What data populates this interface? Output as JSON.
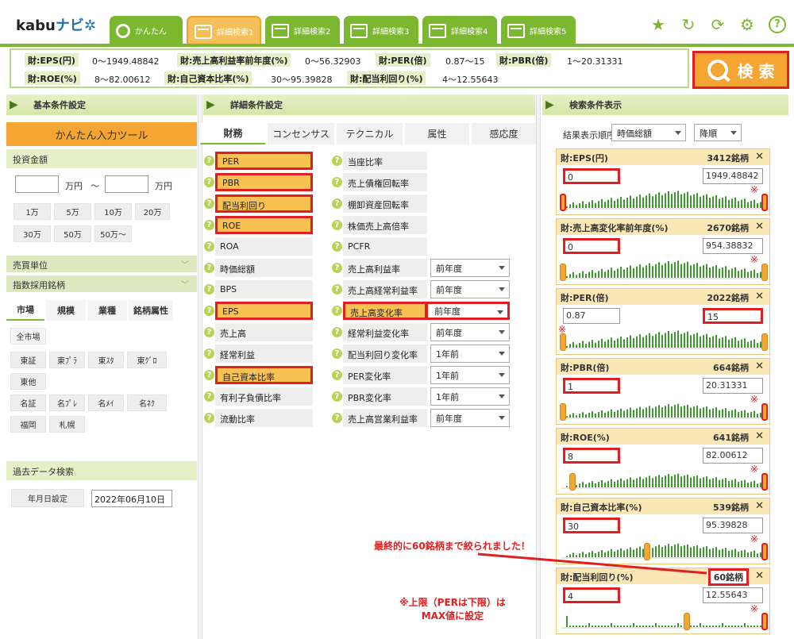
{
  "logo": {
    "prefix": "kabu",
    "accent": "ナビ"
  },
  "tabs": [
    {
      "label": "かんたん"
    },
    {
      "label": "詳細検索1"
    },
    {
      "label": "詳細検索2"
    },
    {
      "label": "詳細検索3"
    },
    {
      "label": "詳細検索4"
    },
    {
      "label": "詳細検索5"
    }
  ],
  "summary": {
    "items": [
      {
        "key": "財:EPS(円)",
        "value": "0〜1949.48842"
      },
      {
        "key": "財:売上高利益率前年度(%)",
        "value": "0〜56.32903"
      },
      {
        "key": "財:PER(倍)",
        "value": "0.87〜15"
      },
      {
        "key": "財:PBR(倍)",
        "value": "1〜20.31331"
      },
      {
        "key": "財:ROE(%)",
        "value": "8〜82.00612"
      },
      {
        "key": "財:自己資本比率(%)",
        "value": "30〜95.39828"
      },
      {
        "key": "財:配当利回り(%)",
        "value": "4〜12.55643"
      }
    ]
  },
  "search_button": "検 索",
  "panels": {
    "basic": "基本条件設定",
    "detail": "詳細条件設定",
    "display": "検索条件表示"
  },
  "left": {
    "easy_tool": "かんたん入力ツール",
    "invest_amount": "投資金額",
    "man_yen": "万円",
    "tilde": "〜",
    "amounts": [
      "1万",
      "5万",
      "10万",
      "20万",
      "30万",
      "50万",
      "50万〜"
    ],
    "trade_unit": "売買単位",
    "index": "指数採用銘柄",
    "market_tabs": [
      "市場",
      "規模",
      "業種",
      "銘柄属性"
    ],
    "markets": [
      "全市場",
      "東証",
      "東ﾌﾟﾗ",
      "東ｽﾀ",
      "東ｸﾞﾛ",
      "東他",
      "名証",
      "名ﾌﾟﾚ",
      "名ﾒｲ",
      "名ﾈｸ",
      "福岡",
      "札幌"
    ],
    "past_search": "過去データ検索",
    "date_label": "年月日設定",
    "date_value": "2022年06月10日"
  },
  "center": {
    "tabs": [
      "財務",
      "コンセンサス",
      "テクニカル",
      "属性",
      "感応度"
    ],
    "col1": [
      "PER",
      "PBR",
      "配当利回り",
      "ROE",
      "ROA",
      "時価総額",
      "BPS",
      "EPS",
      "売上高",
      "経常利益",
      "自己資本比率",
      "有利子負債比率",
      "流動比率"
    ],
    "col2": [
      "当座比率",
      "売上債権回転率",
      "棚卸資産回転率",
      "株価売上高倍率",
      "PCFR",
      "売上高利益率",
      "売上高経常利益率",
      "売上高変化率",
      "経常利益変化率",
      "配当利回り変化率",
      "PER変化率",
      "PBR変化率",
      "売上高営業利益率"
    ],
    "col2_selects": [
      "",
      "",
      "",
      "",
      "",
      "前年度",
      "前年度",
      "前年度",
      "前年度",
      "1年前",
      "1年前",
      "1年前",
      "前年度"
    ]
  },
  "right": {
    "order_label": "結果表示順序",
    "order_value": "時価総額",
    "dir_value": "降順",
    "cards": [
      {
        "title": "財:EPS(円)",
        "count": "3412銘柄",
        "lo": "0",
        "hi": "1949.48842"
      },
      {
        "title": "財:売上高変化率前年度(%)",
        "count": "2670銘柄",
        "lo": "0",
        "hi": "954.38832"
      },
      {
        "title": "財:PER(倍)",
        "count": "2022銘柄",
        "lo": "0.87",
        "hi": "15"
      },
      {
        "title": "財:PBR(倍)",
        "count": "664銘柄",
        "lo": "1",
        "hi": "20.31331"
      },
      {
        "title": "財:ROE(%)",
        "count": "641銘柄",
        "lo": "8",
        "hi": "82.00612"
      },
      {
        "title": "財:自己資本比率(%)",
        "count": "539銘柄",
        "lo": "30",
        "hi": "95.39828"
      },
      {
        "title": "財:配当利回り(%)",
        "count": "60銘柄",
        "lo": "4",
        "hi": "12.55643"
      }
    ]
  },
  "notes": {
    "final": "最終的に60銘柄まで絞られました！",
    "max1": "※上限（PERは下限）は",
    "max2": "MAX値に設定",
    "mark": "※"
  },
  "icons": [
    "star-icon",
    "reload-icon",
    "sync-icon",
    "gear-icon",
    "help-icon"
  ],
  "colors": {
    "green": "#7cb82f",
    "orange": "#f5a531",
    "red": "#e02020"
  }
}
